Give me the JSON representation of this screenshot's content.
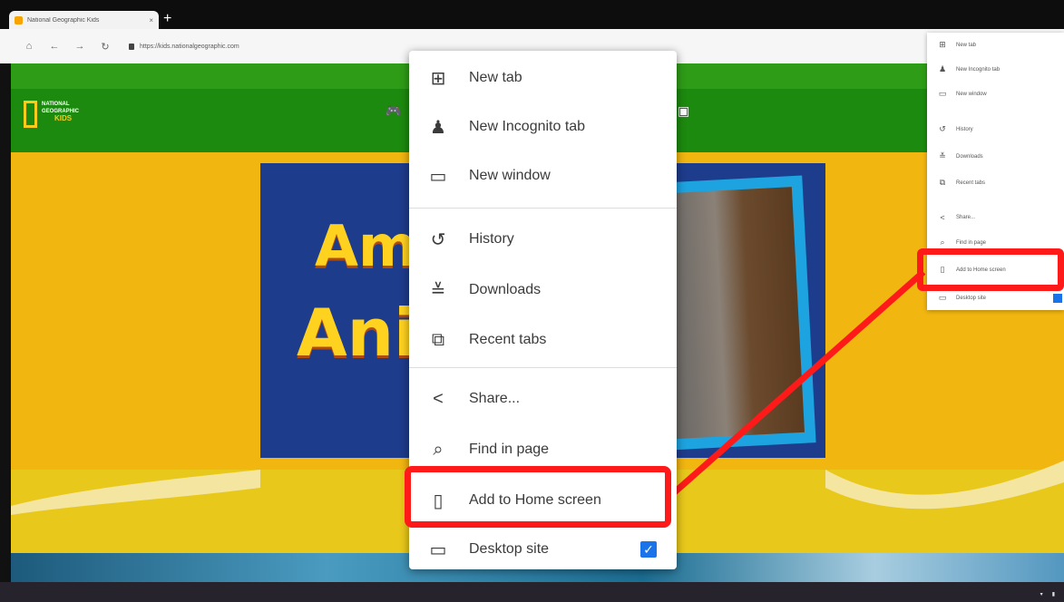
{
  "browser": {
    "tab_title": "National Geographic Kids",
    "tab_close": "×",
    "new_tab_symbol": "+",
    "url": "https://kids.nationalgeographic.com"
  },
  "site": {
    "logo_lines": [
      "NATIONAL",
      "GEOGRAPHIC"
    ],
    "logo_kids": "KIDS",
    "hero_title_1": "Am",
    "hero_title_2": "Ani",
    "accent_color": "#f2b611",
    "header_color": "#2e9c17"
  },
  "main_menu": {
    "items": [
      {
        "label": "New tab",
        "icon": "new-tab-icon"
      },
      {
        "label": "New Incognito tab",
        "icon": "incognito-icon"
      },
      {
        "label": "New window",
        "icon": "new-window-icon"
      },
      {
        "label": "History",
        "icon": "history-icon"
      },
      {
        "label": "Downloads",
        "icon": "downloads-icon"
      },
      {
        "label": "Recent tabs",
        "icon": "recent-tabs-icon"
      },
      {
        "label": "Share...",
        "icon": "share-icon"
      },
      {
        "label": "Find in page",
        "icon": "find-icon"
      },
      {
        "label": "Add to Home screen",
        "icon": "add-home-icon"
      },
      {
        "label": "Desktop site",
        "icon": "desktop-icon"
      }
    ],
    "desktop_site_checked": true,
    "highlight_color": "#ff1a1a"
  },
  "mini_menu": {
    "items": [
      "New tab",
      "New Incognito tab",
      "New window",
      "History",
      "Downloads",
      "Recent tabs",
      "Share...",
      "Find in page",
      "Add to Home screen",
      "Desktop site"
    ]
  }
}
